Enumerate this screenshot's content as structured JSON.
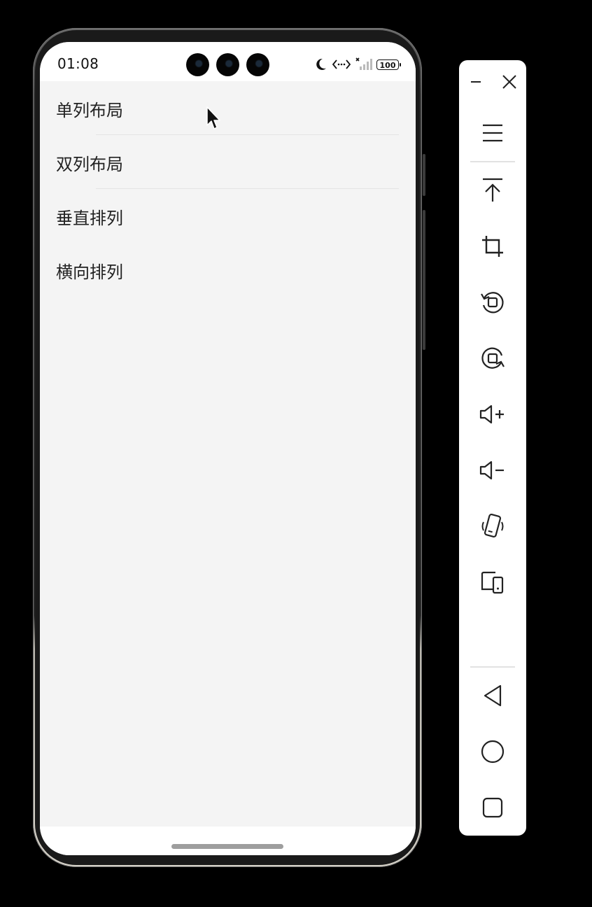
{
  "status_bar": {
    "time": "01:08",
    "battery": "100"
  },
  "list": {
    "items": [
      {
        "label": "单列布局"
      },
      {
        "label": "双列布局"
      },
      {
        "label": "垂直排列"
      },
      {
        "label": "横向排列"
      }
    ]
  },
  "toolbar": {
    "icons": [
      "minimize-icon",
      "close-icon",
      "menu-icon",
      "pin-to-top-icon",
      "crop-icon",
      "rotate-left-icon",
      "rotate-right-icon",
      "volume-up-icon",
      "volume-down-icon",
      "shake-icon",
      "multi-device-icon",
      "back-icon",
      "home-icon",
      "recents-icon"
    ]
  }
}
